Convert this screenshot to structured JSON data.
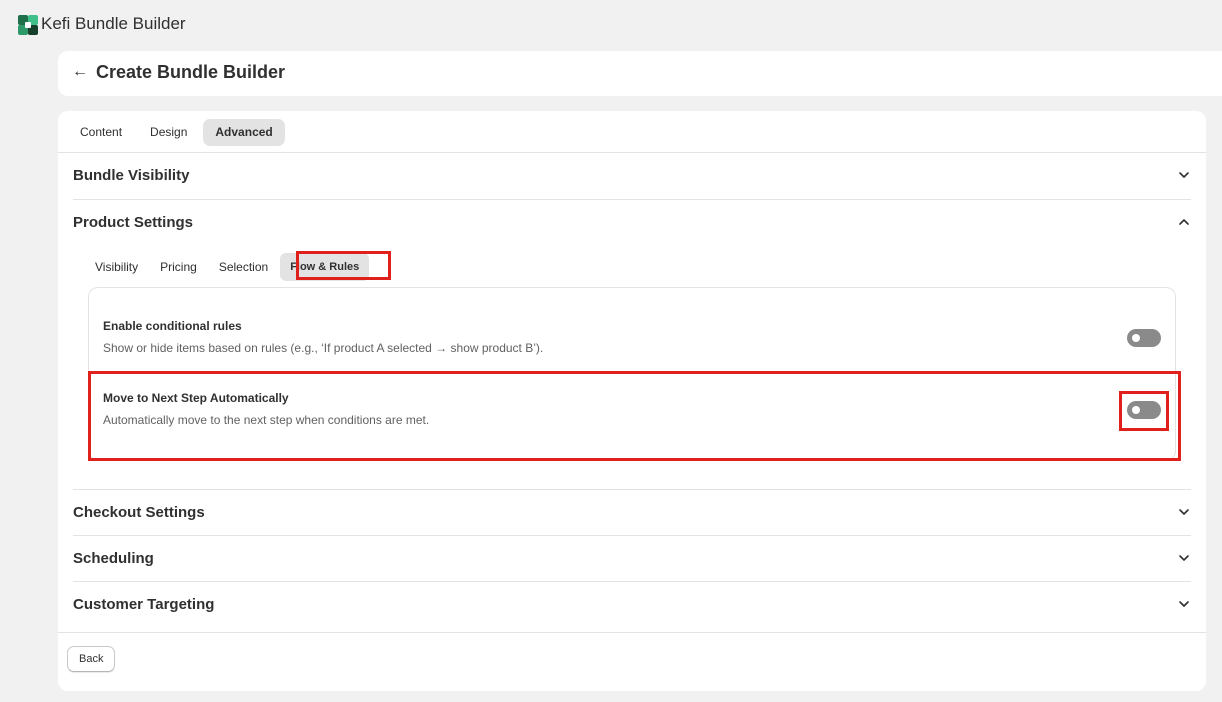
{
  "app": {
    "title": "Kefi Bundle Builder",
    "logo_icon": "kefi-logo-icon"
  },
  "page": {
    "title": "Create Bundle Builder",
    "back_icon": "arrow-left-icon"
  },
  "tabs": [
    {
      "label": "Content",
      "active": false
    },
    {
      "label": "Design",
      "active": false
    },
    {
      "label": "Advanced",
      "active": true
    }
  ],
  "sections": {
    "bundle_visibility": {
      "title": "Bundle Visibility",
      "expanded": false
    },
    "product_settings": {
      "title": "Product Settings",
      "expanded": true,
      "sub_tabs": [
        {
          "label": "Visibility",
          "active": false
        },
        {
          "label": "Pricing",
          "active": false
        },
        {
          "label": "Selection",
          "active": false
        },
        {
          "label": "Flow & Rules",
          "active": true
        }
      ],
      "settings": [
        {
          "title": "Enable conditional rules",
          "description": "Show or hide items based on rules (e.g., ‘If product A selected → show product B’).",
          "enabled": false
        },
        {
          "title": "Move to Next Step Automatically",
          "description": "Automatically move to the next step when conditions are met.",
          "enabled": false
        }
      ]
    },
    "checkout_settings": {
      "title": "Checkout Settings",
      "expanded": false
    },
    "scheduling": {
      "title": "Scheduling",
      "expanded": false
    },
    "customer_targeting": {
      "title": "Customer Targeting",
      "expanded": false
    }
  },
  "footer": {
    "back_label": "Back"
  },
  "colors": {
    "highlight": "#e0211b",
    "toggle_off": "#8a8a8a",
    "tab_active_bg": "#e3e3e3"
  }
}
